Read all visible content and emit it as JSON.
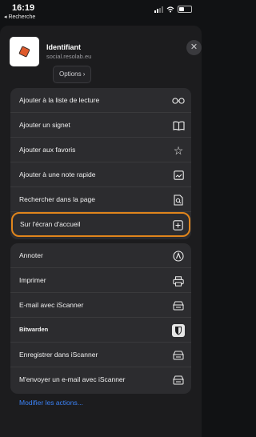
{
  "status_bar": {
    "time": "16:19",
    "back_label": "◂ Recherche"
  },
  "header": {
    "title": "Identifiant",
    "url": "social.resolab.eu",
    "options_label": "Options ›",
    "close_glyph": "✕"
  },
  "group1": [
    {
      "label": "Ajouter à la liste de lecture",
      "icon": "reading-list-icon",
      "glyph": "○○"
    },
    {
      "label": "Ajouter un signet",
      "icon": "book-icon",
      "glyph": "📖"
    },
    {
      "label": "Ajouter aux favoris",
      "icon": "star-icon",
      "glyph": "☆"
    },
    {
      "label": "Ajouter à une note rapide",
      "icon": "quick-note-icon",
      "glyph": "▣"
    },
    {
      "label": "Rechercher dans la page",
      "icon": "find-page-icon",
      "glyph": "🔍"
    },
    {
      "label": "Sur l'écran d'accueil",
      "icon": "add-square-icon",
      "glyph": "⊞"
    }
  ],
  "group2": [
    {
      "label": "Annoter",
      "icon": "markup-icon",
      "glyph": "Ⓐ"
    },
    {
      "label": "Imprimer",
      "icon": "printer-icon",
      "glyph": "⎙"
    },
    {
      "label": "E-mail avec iScanner",
      "icon": "iscanner-icon",
      "glyph": "⌂"
    },
    {
      "label": "Bitwarden",
      "icon": "shield-icon",
      "glyph": "◖"
    },
    {
      "label": "Enregistrer dans iScanner",
      "icon": "iscanner-icon",
      "glyph": "⌂"
    },
    {
      "label": "M'envoyer un e-mail avec iScanner",
      "icon": "iscanner-icon",
      "glyph": "⌂"
    }
  ],
  "footer": {
    "modify_label": "Modifier les actions..."
  },
  "colors": {
    "highlight": "#e0851c",
    "link": "#3b82f6"
  }
}
